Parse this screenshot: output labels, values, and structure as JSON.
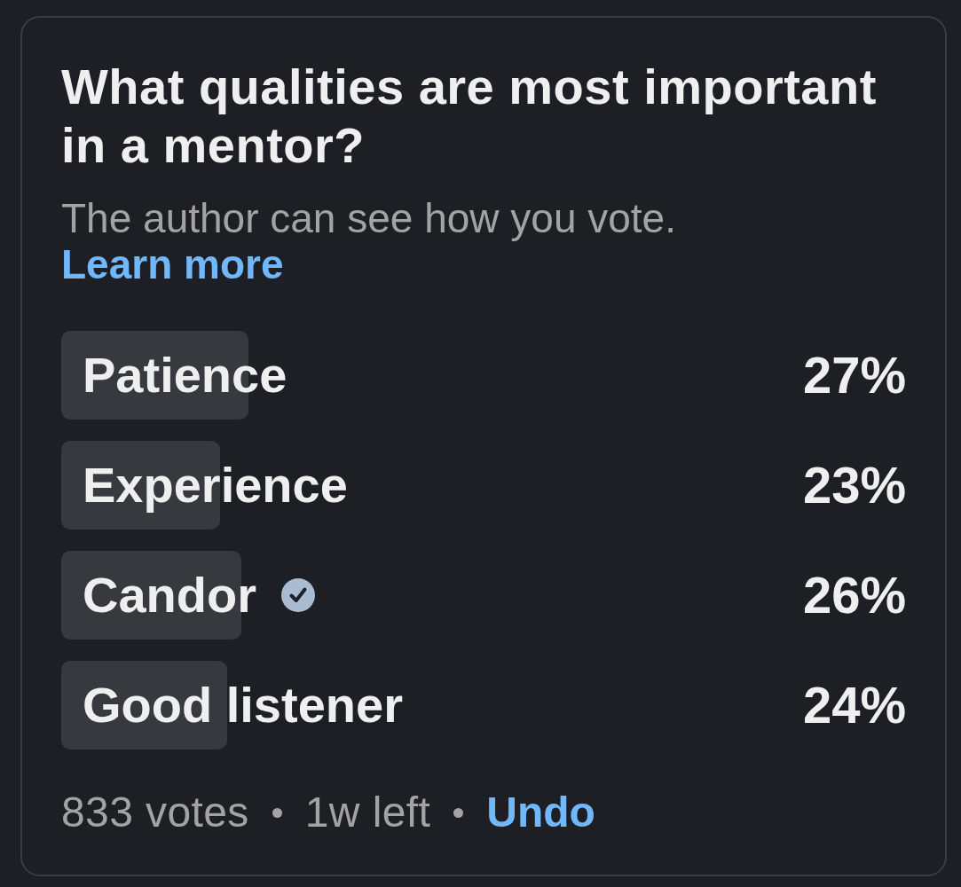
{
  "poll": {
    "question": "What qualities are most important in a mentor?",
    "notice": {
      "text": "The author can see how you vote.",
      "link": "Learn more"
    },
    "options": [
      {
        "label": "Patience",
        "level": 0.27,
        "percent": "27%",
        "selected": false
      },
      {
        "label": "Experience",
        "level": 0.23,
        "percent": "23%",
        "selected": false
      },
      {
        "label": "Candor",
        "level": 0.26,
        "percent": "26%",
        "selected": true
      },
      {
        "label": "Good listener",
        "level": 0.24,
        "percent": "24%",
        "selected": false
      }
    ],
    "footer": [
      {
        "kind": "text",
        "text": "833 votes"
      },
      {
        "kind": "text",
        "text": "1w left"
      },
      {
        "kind": "link",
        "text": "Undo"
      }
    ]
  }
}
